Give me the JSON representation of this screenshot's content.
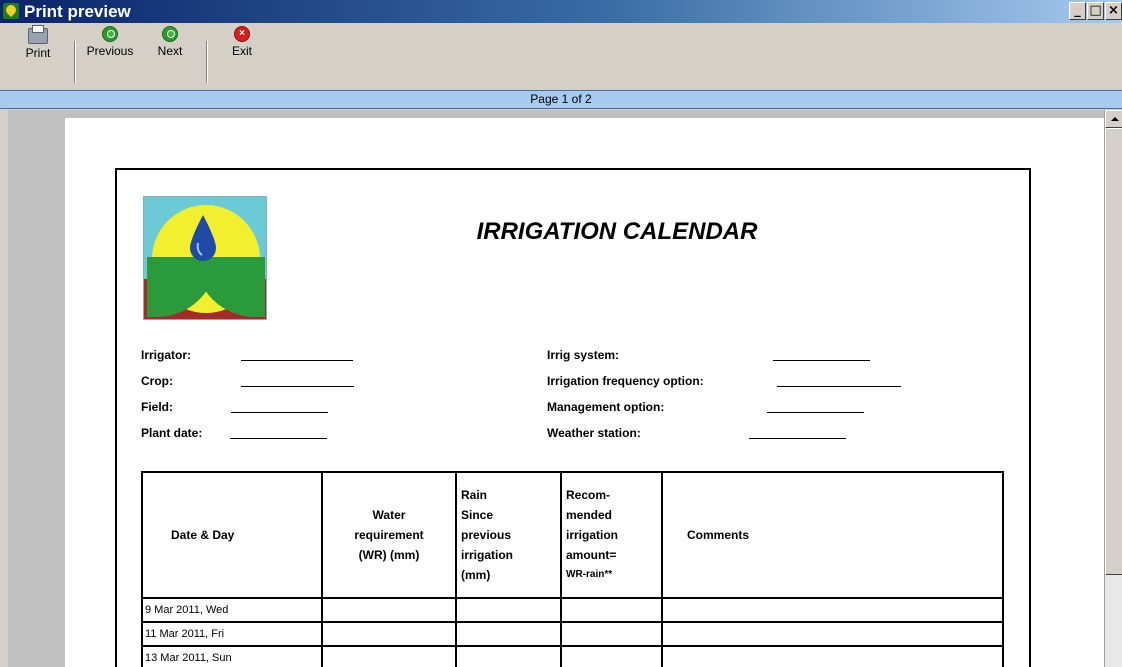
{
  "window": {
    "title": "Print preview",
    "controls": {
      "minimize": "_",
      "maximize": "□",
      "close": "×"
    }
  },
  "toolbar": {
    "print_label": "Print",
    "previous_label": "Previous",
    "next_label": "Next",
    "exit_label": "Exit"
  },
  "pagebar": {
    "text": "Page 1 of 2"
  },
  "form": {
    "title": "IRRIGATION CALENDAR",
    "fields_left": [
      "Irrigator:",
      "Crop:",
      "Field:",
      "Plant date:"
    ],
    "fields_right": [
      "Irrig system:",
      "Irrigation frequency option:",
      "Management option:",
      "Weather station:"
    ]
  },
  "table": {
    "headers": {
      "date": "Date & Day",
      "water": [
        "Water",
        "requirement",
        "(WR) (mm)"
      ],
      "rain": [
        "Rain",
        "Since",
        "previous",
        "irrigation",
        "(mm)"
      ],
      "rec": [
        "Recom-",
        "mended",
        "irrigation",
        "amount=",
        "WR-rain**"
      ],
      "comments": "Comments"
    },
    "rows": [
      "9 Mar 2011, Wed",
      "11 Mar 2011, Fri",
      "13 Mar 2011, Sun"
    ]
  }
}
